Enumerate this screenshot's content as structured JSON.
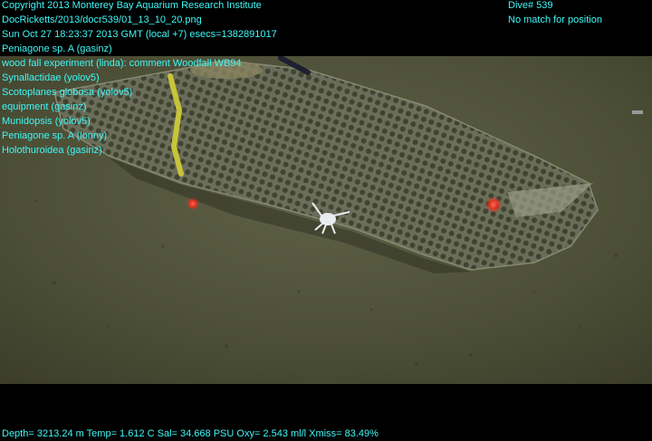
{
  "overlay": {
    "header_left": [
      "Copyright 2013 Monterey Bay Aquarium Research Institute",
      "DocRicketts/2013/docr539/01_13_10_20.png",
      "Sun Oct 27 18:23:37 2013 GMT (local +7)  esecs=1382891017"
    ],
    "annotations": [
      "Peniagone sp. A (gasinz)",
      "wood fall experiment (linda): comment Woodfall WB94",
      "Synallactidae (yolov5)",
      "Scotoplanes globosa (yolov5)",
      "equipment (gasinz)",
      "Munidopsis (yolov5)",
      "Peniagone sp. A (lonny)",
      "Holothuroidea (gasinz)"
    ],
    "header_right": [
      "Dive# 539",
      "No match for position"
    ],
    "footer": "Depth= 3213.24 m  Temp= 1.612 C  Sal= 34.668 PSU  Oxy= 2.543 ml/l  Xmiss= 83.49%"
  },
  "colors": {
    "overlay_text": "#3ff7f7",
    "seafloor": "#4f5238",
    "laser": "#ff2a1a",
    "strap": "#c8c43a"
  }
}
